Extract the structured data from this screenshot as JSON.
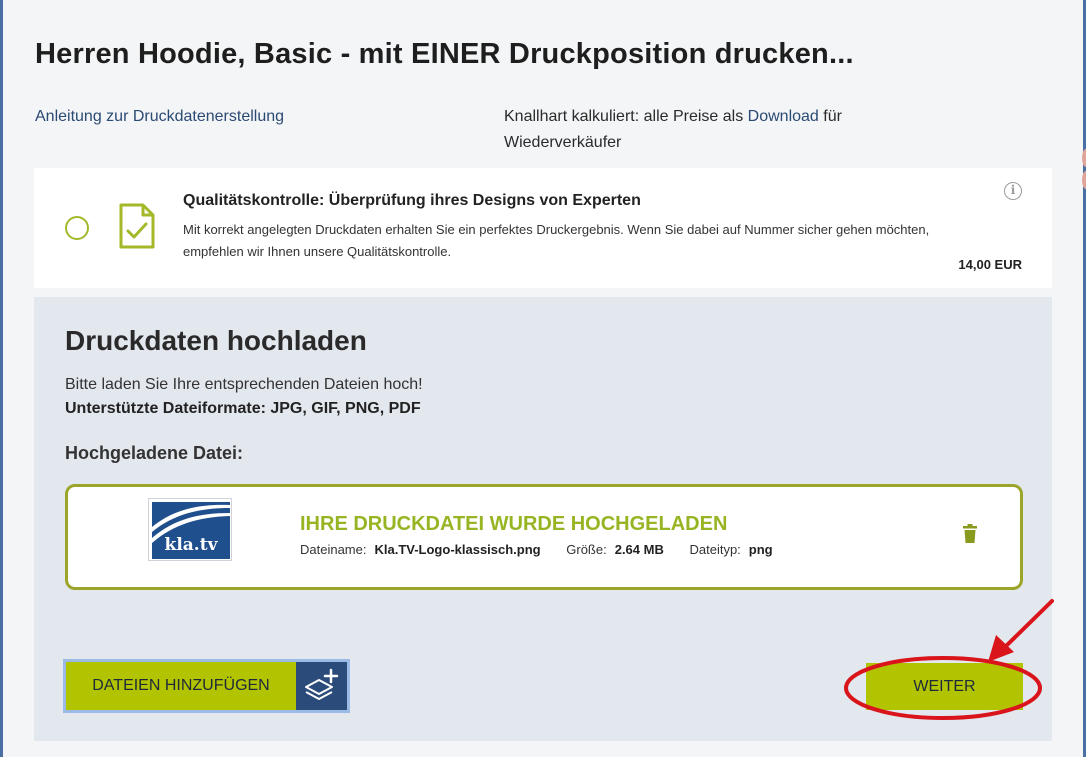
{
  "page": {
    "title": "Herren Hoodie, Basic - mit EINER Druckposition drucken...",
    "guide_link": "Anleitung zur Druckdatenerstellung",
    "promo_prefix": "Knallhart kalkuliert: alle Preise als ",
    "promo_link": "Download",
    "promo_suffix": " für Wiederverkäufer"
  },
  "quality_check": {
    "title": "Qualitätskontrolle: Überprüfung ihres Designs von Experten",
    "description": "Mit korrekt angelegten Druckdaten erhalten Sie ein perfektes Druckergebnis. Wenn Sie dabei auf Nummer sicher gehen möchten, empfehlen wir Ihnen unsere Qualitätskontrolle.",
    "price": "14,00 EUR",
    "info_glyph": "i",
    "selected": false
  },
  "upload": {
    "title": "Druckdaten hochladen",
    "hint": "Bitte laden Sie Ihre entsprechenden Dateien hoch!",
    "formats": "Unterstützte Dateiformate: JPG, GIF, PNG, PDF",
    "uploaded_label": "Hochgeladene Datei:",
    "file": {
      "status": "IHRE DRUCKDATEI WURDE HOCHGELADEN",
      "name_label": "Dateiname:",
      "name_value": "Kla.TV-Logo-klassisch.png",
      "size_label": "Größe:",
      "size_value": "2.64 MB",
      "type_label": "Dateityp:",
      "type_value": "png",
      "thumbnail_text": "kla.tv"
    },
    "add_files_label": "DATEIEN HINZUFÜGEN",
    "next_label": "WEITER"
  },
  "colors": {
    "accent_green": "#b2c400",
    "status_green": "#97b523",
    "navy": "#2b4b7a",
    "annotation_red": "#d9141b"
  },
  "icons": {
    "document_check": "document-check-icon",
    "info": "info-icon",
    "trash": "trash-icon",
    "layers_add": "layers-add-icon"
  }
}
